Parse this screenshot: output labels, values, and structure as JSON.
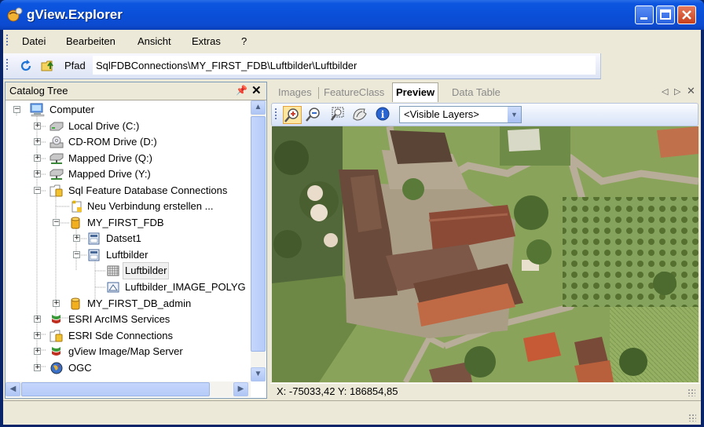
{
  "app": {
    "title": "gView.Explorer"
  },
  "menu": {
    "items": [
      "Datei",
      "Bearbeiten",
      "Ansicht",
      "Extras",
      "?"
    ]
  },
  "pathbar": {
    "label": "Pfad",
    "value": "SqlFDBConnections\\MY_FIRST_FDB\\Luftbilder\\Luftbilder"
  },
  "catalog": {
    "title": "Catalog Tree",
    "items": [
      {
        "label": "Computer"
      },
      {
        "label": "Local Drive (C:)"
      },
      {
        "label": "CD-ROM Drive (D:)"
      },
      {
        "label": "Mapped Drive (Q:)"
      },
      {
        "label": "Mapped Drive (Y:)"
      },
      {
        "label": "Sql Feature Database Connections"
      },
      {
        "label": "Neu Verbindung erstellen ..."
      },
      {
        "label": "MY_FIRST_FDB"
      },
      {
        "label": "Datset1"
      },
      {
        "label": "Luftbilder"
      },
      {
        "label": "Luftbilder"
      },
      {
        "label": "Luftbilder_IMAGE_POLYG"
      },
      {
        "label": "MY_FIRST_DB_admin"
      },
      {
        "label": "ESRI ArcIMS Services"
      },
      {
        "label": "ESRI Sde Connections"
      },
      {
        "label": "gView Image/Map Server"
      },
      {
        "label": "OGC"
      }
    ]
  },
  "tabs": {
    "items": [
      "Images",
      "FeatureClass",
      "Preview",
      "Data Table"
    ],
    "active": "Preview"
  },
  "map_toolbar": {
    "layer_select": "<Visible Layers>"
  },
  "status": {
    "coords": "X: -75033,42  Y: 186854,85"
  },
  "colors": {
    "title_bar": "#0a4fd8",
    "accent": "#316ac5"
  }
}
